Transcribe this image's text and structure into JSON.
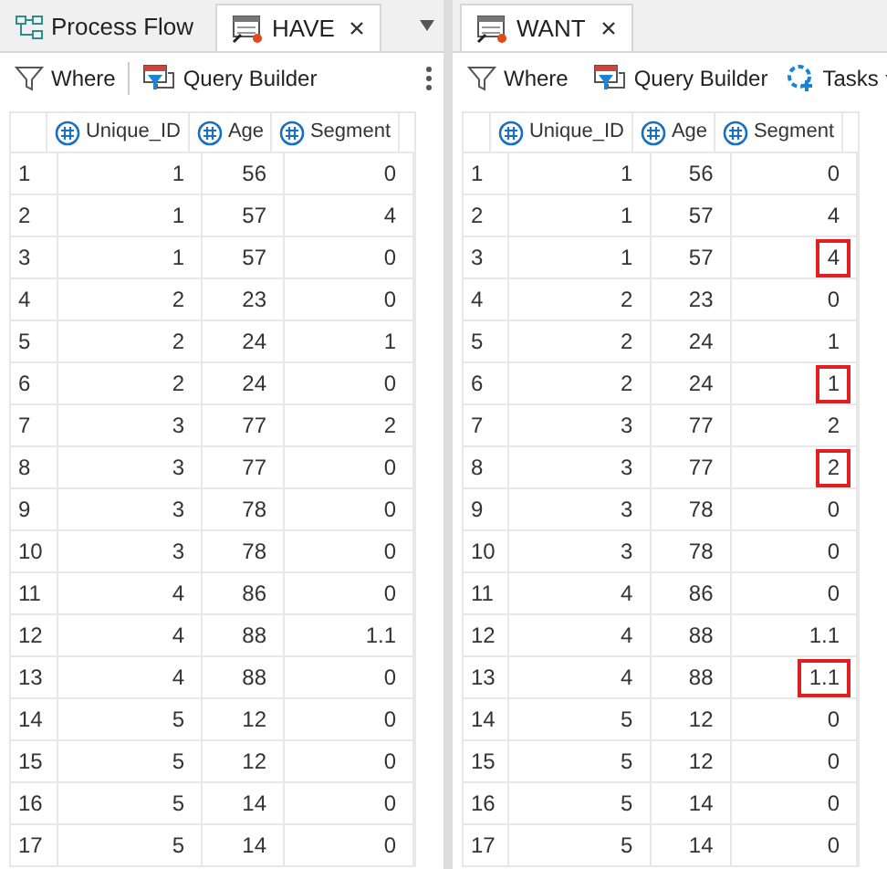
{
  "left_panel": {
    "tabs": [
      {
        "label": "Process Flow",
        "kind": "flow",
        "selected": false,
        "closable": false
      },
      {
        "label": "HAVE",
        "kind": "table",
        "selected": true,
        "closable": true
      }
    ],
    "toolbar": {
      "where": "Where",
      "query_builder": "Query Builder",
      "has_more": true
    },
    "table": {
      "columns": [
        "Unique_ID",
        "Age",
        "Segment"
      ],
      "rows": [
        {
          "n": "1",
          "unique_id": "1",
          "age": "56",
          "segment": "0"
        },
        {
          "n": "2",
          "unique_id": "1",
          "age": "57",
          "segment": "4"
        },
        {
          "n": "3",
          "unique_id": "1",
          "age": "57",
          "segment": "0"
        },
        {
          "n": "4",
          "unique_id": "2",
          "age": "23",
          "segment": "0"
        },
        {
          "n": "5",
          "unique_id": "2",
          "age": "24",
          "segment": "1"
        },
        {
          "n": "6",
          "unique_id": "2",
          "age": "24",
          "segment": "0"
        },
        {
          "n": "7",
          "unique_id": "3",
          "age": "77",
          "segment": "2"
        },
        {
          "n": "8",
          "unique_id": "3",
          "age": "77",
          "segment": "0"
        },
        {
          "n": "9",
          "unique_id": "3",
          "age": "78",
          "segment": "0"
        },
        {
          "n": "10",
          "unique_id": "3",
          "age": "78",
          "segment": "0"
        },
        {
          "n": "11",
          "unique_id": "4",
          "age": "86",
          "segment": "0"
        },
        {
          "n": "12",
          "unique_id": "4",
          "age": "88",
          "segment": "1.1"
        },
        {
          "n": "13",
          "unique_id": "4",
          "age": "88",
          "segment": "0"
        },
        {
          "n": "14",
          "unique_id": "5",
          "age": "12",
          "segment": "0"
        },
        {
          "n": "15",
          "unique_id": "5",
          "age": "12",
          "segment": "0"
        },
        {
          "n": "16",
          "unique_id": "5",
          "age": "14",
          "segment": "0"
        },
        {
          "n": "17",
          "unique_id": "5",
          "age": "14",
          "segment": "0"
        }
      ]
    }
  },
  "right_panel": {
    "tabs": [
      {
        "label": "WANT",
        "kind": "table",
        "selected": true,
        "closable": true
      }
    ],
    "toolbar": {
      "where": "Where",
      "query_builder": "Query Builder",
      "tasks": "Tasks"
    },
    "table": {
      "columns": [
        "Unique_ID",
        "Age",
        "Segment"
      ],
      "rows": [
        {
          "n": "1",
          "unique_id": "1",
          "age": "56",
          "segment": "0",
          "highlighted": false
        },
        {
          "n": "2",
          "unique_id": "1",
          "age": "57",
          "segment": "4",
          "highlighted": false
        },
        {
          "n": "3",
          "unique_id": "1",
          "age": "57",
          "segment": "4",
          "highlighted": true
        },
        {
          "n": "4",
          "unique_id": "2",
          "age": "23",
          "segment": "0",
          "highlighted": false
        },
        {
          "n": "5",
          "unique_id": "2",
          "age": "24",
          "segment": "1",
          "highlighted": false
        },
        {
          "n": "6",
          "unique_id": "2",
          "age": "24",
          "segment": "1",
          "highlighted": true
        },
        {
          "n": "7",
          "unique_id": "3",
          "age": "77",
          "segment": "2",
          "highlighted": false
        },
        {
          "n": "8",
          "unique_id": "3",
          "age": "77",
          "segment": "2",
          "highlighted": true
        },
        {
          "n": "9",
          "unique_id": "3",
          "age": "78",
          "segment": "0",
          "highlighted": false
        },
        {
          "n": "10",
          "unique_id": "3",
          "age": "78",
          "segment": "0",
          "highlighted": false
        },
        {
          "n": "11",
          "unique_id": "4",
          "age": "86",
          "segment": "0",
          "highlighted": false
        },
        {
          "n": "12",
          "unique_id": "4",
          "age": "88",
          "segment": "1.1",
          "highlighted": false
        },
        {
          "n": "13",
          "unique_id": "4",
          "age": "88",
          "segment": "1.1",
          "highlighted": true
        },
        {
          "n": "14",
          "unique_id": "5",
          "age": "12",
          "segment": "0",
          "highlighted": false
        },
        {
          "n": "15",
          "unique_id": "5",
          "age": "12",
          "segment": "0",
          "highlighted": false
        },
        {
          "n": "16",
          "unique_id": "5",
          "age": "14",
          "segment": "0",
          "highlighted": false
        },
        {
          "n": "17",
          "unique_id": "5",
          "age": "14",
          "segment": "0",
          "highlighted": false
        }
      ]
    }
  }
}
